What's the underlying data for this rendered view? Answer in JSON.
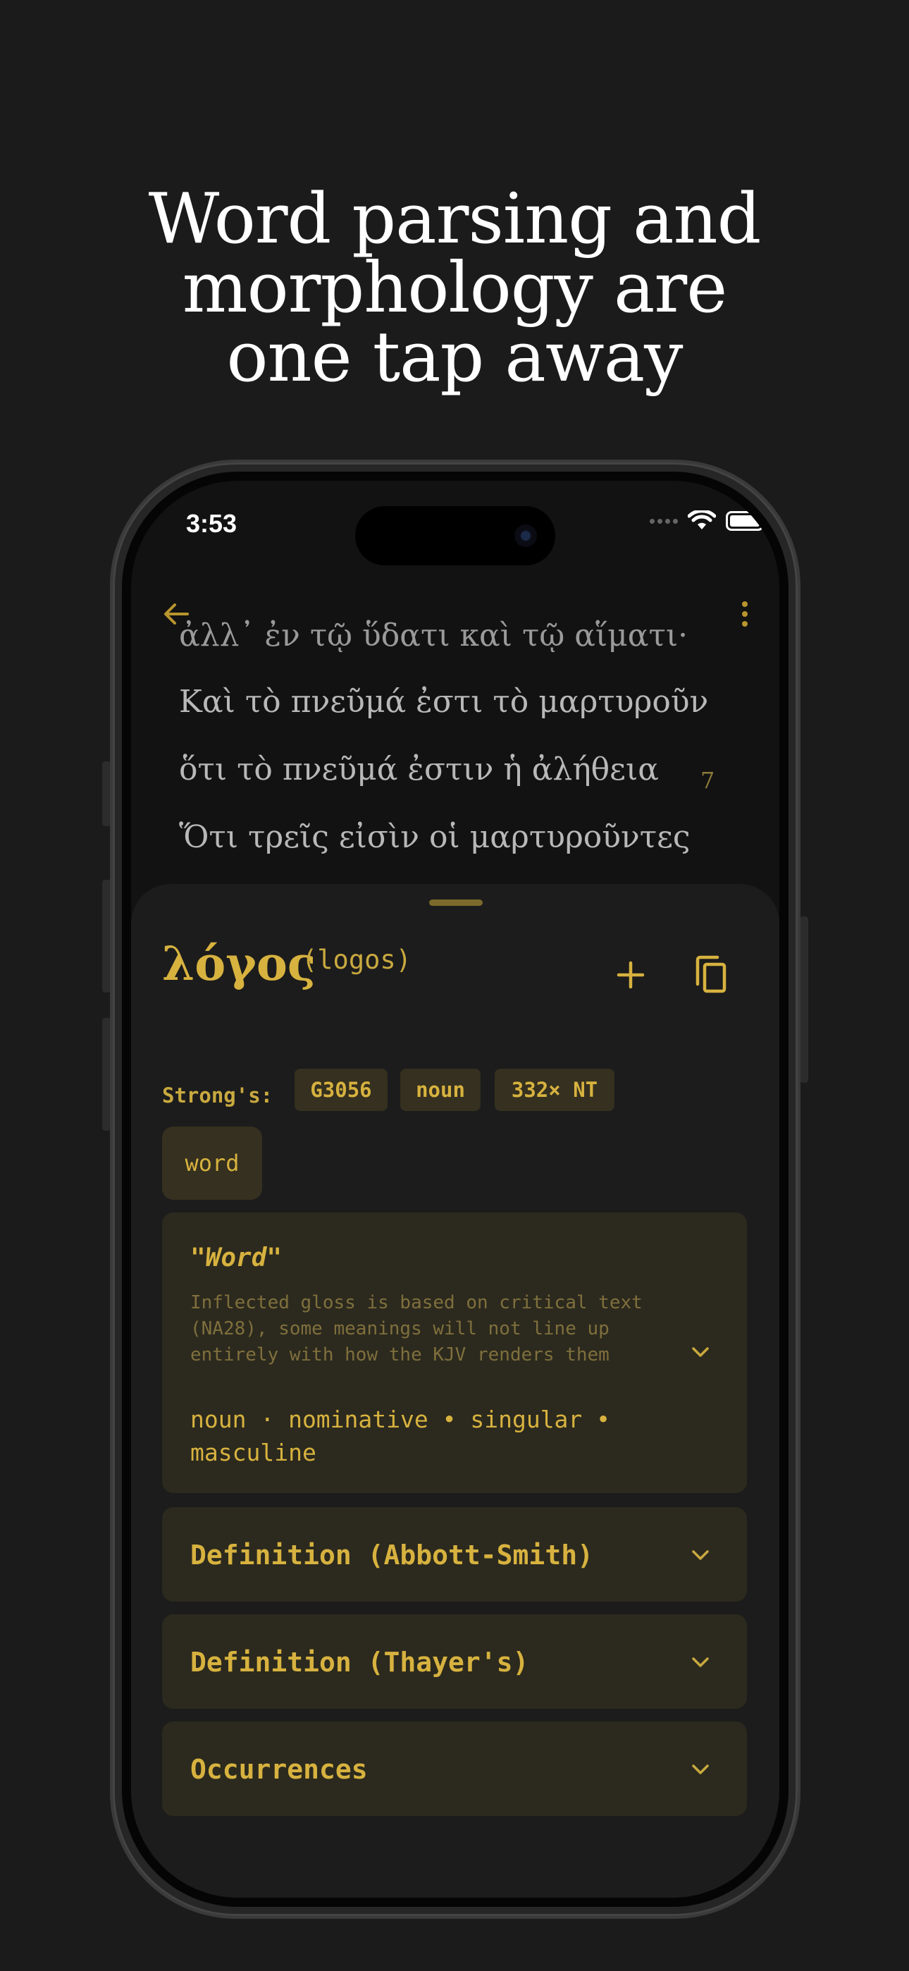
{
  "headline": {
    "line1": "Word parsing and",
    "line2": "morphology are",
    "line3": "one tap away"
  },
  "status_bar": {
    "time": "3:53",
    "icons": [
      "cellular-signal-icon",
      "wifi-icon",
      "battery-icon"
    ]
  },
  "toolbar": {
    "back_icon": "arrow-left-icon",
    "more_icon": "more-vertical-icon"
  },
  "reader": {
    "lines": [
      "ἀλλ᾽ ἐν τῷ ὕδατι καὶ τῷ αἵματι·",
      "Καὶ τὸ πνεῦμά ἐστι τὸ μαρτυροῦν",
      "ὅτι τὸ πνεῦμά ἐστιν ἡ ἀλήθεια",
      "Ὅτι τρεῖς εἰσὶν οἱ μαρτυροῦντες"
    ],
    "verse_number": "7"
  },
  "word_sheet": {
    "lemma": "λόγος",
    "transliteration": "(logos)",
    "add_icon": "plus-icon",
    "copy_icon": "copy-icon",
    "strongs_label": "Strong's:",
    "chips": [
      "G3056",
      "noun",
      "332× NT"
    ],
    "gloss_chip": "word",
    "gloss_card": {
      "title": "\"Word\"",
      "note": "Inflected gloss is based on critical text (NA28), some meanings will not line up entirely with how the KJV renders them",
      "parsing": "noun · nominative • singular • masculine"
    },
    "accordions": [
      "Definition (Abbott-Smith)",
      "Definition (Thayer's)",
      "Occurrences"
    ]
  },
  "colors": {
    "background": "#1b1b1b",
    "accent_gold": "#d7b23f",
    "chip_bg": "#35301f",
    "card_bg": "#2c2a1e"
  }
}
